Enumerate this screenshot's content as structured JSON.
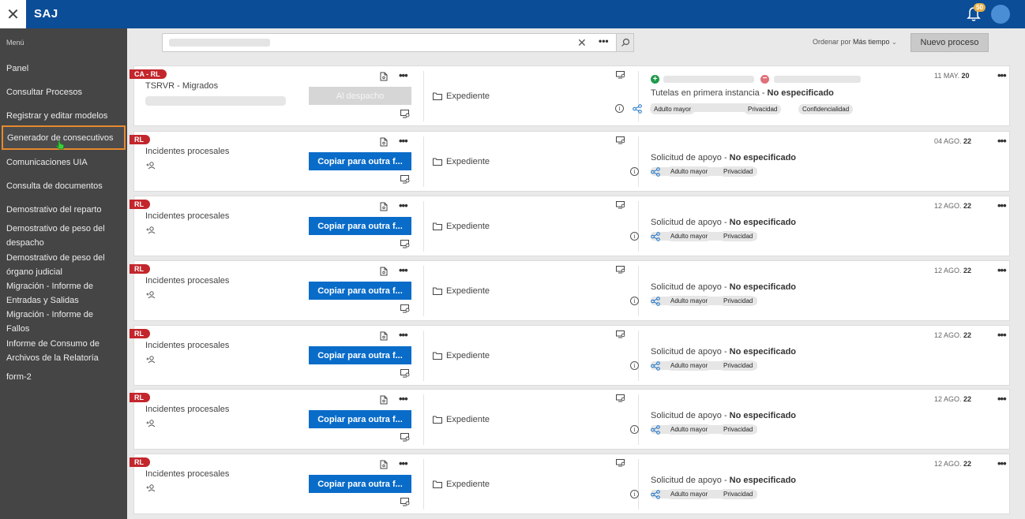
{
  "header": {
    "close_glyph": "✕",
    "app_title": "SAJ",
    "notification_count": "50"
  },
  "sidebar": {
    "menu_title": "Menú",
    "items": [
      {
        "label": "Panel"
      },
      {
        "label": "Consultar Procesos"
      },
      {
        "label": "Registrar y editar modelos"
      },
      {
        "label": "Generador de consecutivos"
      },
      {
        "label": "Comunicaciones UIA"
      },
      {
        "label": "Consulta de documentos"
      },
      {
        "label": "Demostrativo del reparto"
      },
      {
        "label": "Demostrativo de peso del despacho"
      },
      {
        "label": "Demostrativo de peso del órgano judicial"
      },
      {
        "label": "Migración - Informe de Entradas y Salidas"
      },
      {
        "label": "Migración - Informe de Fallos"
      },
      {
        "label": "Informe de Consumo de Archivos de la Relatoría"
      },
      {
        "label": "form-2"
      }
    ]
  },
  "toolbar": {
    "clear_glyph": "✕",
    "more_glyph": "•••",
    "sort_label": "Ordenar por",
    "sort_value": "Más tiempo",
    "new_process_label": "Nuevo proceso"
  },
  "cards": [
    {
      "tag": "CA - RL",
      "title": "TSRVR - Migrados",
      "button": "Al despacho",
      "folder_label": "Expediente",
      "date_day": "11 MAY.",
      "date_year": "20",
      "subject": "Tutelas en primera instancia - ",
      "subject_value": "No especificado",
      "chips": [
        "Adulto mayor",
        "Privacidad",
        "Confidencialidad"
      ]
    },
    {
      "tag": "RL",
      "title": "Incidentes procesales",
      "button": "Copiar para outra f...",
      "folder_label": "Expediente",
      "date_day": "04 AGO.",
      "date_year": "22",
      "subject": "Solicitud de apoyo - ",
      "subject_value": "No especificado",
      "chips": [
        "Adulto mayor",
        "Privacidad"
      ]
    },
    {
      "tag": "RL",
      "title": "Incidentes procesales",
      "button": "Copiar para outra f...",
      "folder_label": "Expediente",
      "date_day": "12 AGO.",
      "date_year": "22",
      "subject": "Solicitud de apoyo - ",
      "subject_value": "No especificado",
      "chips": [
        "Adulto mayor",
        "Privacidad"
      ]
    },
    {
      "tag": "RL",
      "title": "Incidentes procesales",
      "button": "Copiar para outra f...",
      "folder_label": "Expediente",
      "date_day": "12 AGO.",
      "date_year": "22",
      "subject": "Solicitud de apoyo - ",
      "subject_value": "No especificado",
      "chips": [
        "Adulto mayor",
        "Privacidad"
      ]
    },
    {
      "tag": "RL",
      "title": "Incidentes procesales",
      "button": "Copiar para outra f...",
      "folder_label": "Expediente",
      "date_day": "12 AGO.",
      "date_year": "22",
      "subject": "Solicitud de apoyo - ",
      "subject_value": "No especificado",
      "chips": [
        "Adulto mayor",
        "Privacidad"
      ]
    },
    {
      "tag": "RL",
      "title": "Incidentes procesales",
      "button": "Copiar para outra f...",
      "folder_label": "Expediente",
      "date_day": "12 AGO.",
      "date_year": "22",
      "subject": "Solicitud de apoyo - ",
      "subject_value": "No especificado",
      "chips": [
        "Adulto mayor",
        "Privacidad"
      ]
    },
    {
      "tag": "RL",
      "title": "Incidentes procesales",
      "button": "Copiar para outra f...",
      "folder_label": "Expediente",
      "date_day": "12 AGO.",
      "date_year": "22",
      "subject": "Solicitud de apoyo - ",
      "subject_value": "No especificado",
      "chips": [
        "Adulto mayor",
        "Privacidad"
      ]
    }
  ]
}
